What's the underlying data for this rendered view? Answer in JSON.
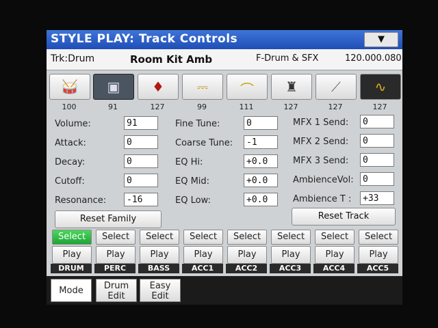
{
  "window": {
    "title": "STYLE PLAY: Track Controls",
    "menu_glyph": "▼"
  },
  "info": {
    "track": "Trk:Drum",
    "sound": "Room Kit Amb",
    "category": "F-Drum & SFX",
    "bank": "120.000.080"
  },
  "tracks_icons": [
    {
      "glyph": "🥁",
      "value": "100"
    },
    {
      "glyph": "▣",
      "value": "91"
    },
    {
      "glyph": "♦",
      "value": "127"
    },
    {
      "glyph": "⎓",
      "value": "99"
    },
    {
      "glyph": "⌒",
      "value": "111"
    },
    {
      "glyph": "♜",
      "value": "127"
    },
    {
      "glyph": "⟋",
      "value": "127"
    },
    {
      "glyph": "∿",
      "value": "127"
    }
  ],
  "params_left": [
    {
      "label": "Volume:",
      "value": "91"
    },
    {
      "label": "Attack:",
      "value": "0"
    },
    {
      "label": "Decay:",
      "value": "0"
    },
    {
      "label": "Cutoff:",
      "value": "0"
    },
    {
      "label": "Resonance:",
      "value": "-16"
    }
  ],
  "params_mid": [
    {
      "label": "Fine Tune:",
      "value": "0"
    },
    {
      "label": "Coarse Tune:",
      "value": "-1"
    },
    {
      "label": "EQ Hi:",
      "value": "+0.0"
    },
    {
      "label": "EQ Mid:",
      "value": "+0.0"
    },
    {
      "label": "EQ Low:",
      "value": "+0.0"
    }
  ],
  "params_right": [
    {
      "label": "MFX 1 Send:",
      "value": "0"
    },
    {
      "label": "MFX 2 Send:",
      "value": "0"
    },
    {
      "label": "MFX 3 Send:",
      "value": "0"
    },
    {
      "label": "AmbienceVol:",
      "value": "0"
    },
    {
      "label": "Ambience T :",
      "value": "+33"
    }
  ],
  "buttons": {
    "reset_family": "Reset Family",
    "reset_track": "Reset Track"
  },
  "tracks": [
    {
      "select": "Select",
      "play": "Play",
      "name": "DRUM"
    },
    {
      "select": "Select",
      "play": "Play",
      "name": "PERC"
    },
    {
      "select": "Select",
      "play": "Play",
      "name": "BASS"
    },
    {
      "select": "Select",
      "play": "Play",
      "name": "ACC1"
    },
    {
      "select": "Select",
      "play": "Play",
      "name": "ACC2"
    },
    {
      "select": "Select",
      "play": "Play",
      "name": "ACC3"
    },
    {
      "select": "Select",
      "play": "Play",
      "name": "ACC4"
    },
    {
      "select": "Select",
      "play": "Play",
      "name": "ACC5"
    }
  ],
  "tabs": [
    {
      "line1": "Mode",
      "line2": ""
    },
    {
      "line1": "Drum",
      "line2": "Edit"
    },
    {
      "line1": "Easy",
      "line2": "Edit"
    }
  ],
  "colors": {
    "title_blue": "#2a5fc8",
    "select_green": "#2bb643"
  }
}
